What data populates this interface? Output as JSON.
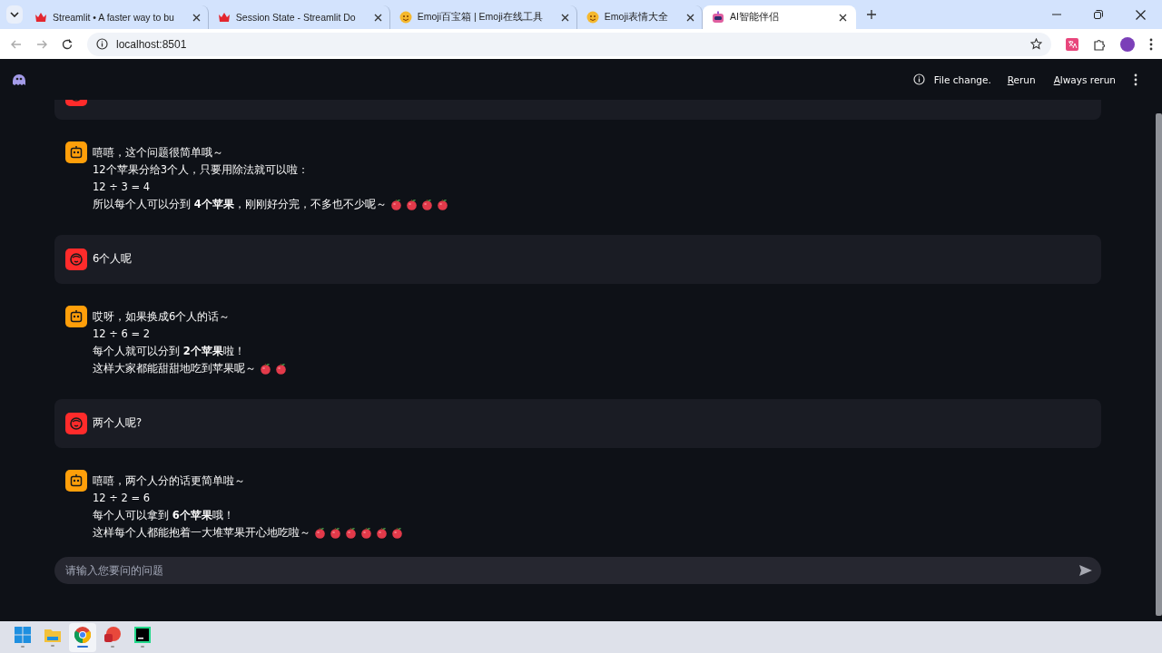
{
  "browser": {
    "tabs": [
      {
        "title": "Streamlit • A faster way to bu",
        "kind": "crown",
        "selected": false
      },
      {
        "title": "Session State - Streamlit Do",
        "kind": "crown",
        "selected": false
      },
      {
        "title": "Emoji百宝箱 | Emoji在线工具",
        "kind": "emoji",
        "selected": false
      },
      {
        "title": "Emoji表情大全",
        "kind": "emoji",
        "selected": false
      },
      {
        "title": "AI智能伴侣",
        "kind": "robot",
        "selected": true
      }
    ],
    "address": "localhost:8501"
  },
  "app": {
    "status": "File change.",
    "actions": [
      "Rerun",
      "Always rerun"
    ]
  },
  "messages": [
    {
      "kind": "user"
    },
    {
      "kind": "assistant",
      "lines": [
        {
          "text": "嘻嘻，这个问题很简单哦～"
        },
        {
          "text": "12个苹果分给3个人，只要用除法就可以啦："
        },
        {
          "text": "12 ÷ 3 = 4"
        },
        {
          "text": "所以每个人可以分到 **4个苹果**，刚刚好分完，不多也不少呢～",
          "icons": [
            {
              "kind": "apple"
            },
            {
              "kind": "apple"
            },
            {
              "kind": "apple"
            },
            {
              "kind": "apple"
            }
          ]
        }
      ]
    },
    {
      "kind": "user",
      "lines": [
        {
          "text": "6个人呢"
        }
      ]
    },
    {
      "kind": "assistant",
      "lines": [
        {
          "text": "哎呀，如果换成6个人的话～"
        },
        {
          "text": "12 ÷ 6 = 2"
        },
        {
          "text": "每个人就可以分到 **2个苹果**啦！"
        },
        {
          "text": "这样大家都能甜甜地吃到苹果呢～",
          "icons": [
            {
              "kind": "apple"
            },
            {
              "kind": "apple"
            }
          ]
        }
      ]
    },
    {
      "kind": "user",
      "lines": [
        {
          "text": "两个人呢?"
        }
      ]
    },
    {
      "kind": "assistant",
      "lines": [
        {
          "text": "嘻嘻，两个人分的话更简单啦～"
        },
        {
          "text": "12 ÷ 2 = 6"
        },
        {
          "text": "每个人可以拿到 **6个苹果**哦！"
        },
        {
          "text": "这样每个人都能抱着一大堆苹果开心地吃啦～",
          "icons": [
            {
              "kind": "apple"
            },
            {
              "kind": "apple"
            },
            {
              "kind": "apple"
            },
            {
              "kind": "apple"
            },
            {
              "kind": "apple"
            },
            {
              "kind": "apple"
            }
          ]
        }
      ]
    }
  ],
  "chat_input": {
    "placeholder": "请输入您要问的问题"
  },
  "taskbar": {
    "apps": [
      {
        "kind": "start",
        "selected": false
      },
      {
        "kind": "files",
        "selected": false
      },
      {
        "kind": "browser",
        "selected": true
      },
      {
        "kind": "slides",
        "selected": false
      },
      {
        "kind": "ide",
        "selected": false
      }
    ]
  }
}
